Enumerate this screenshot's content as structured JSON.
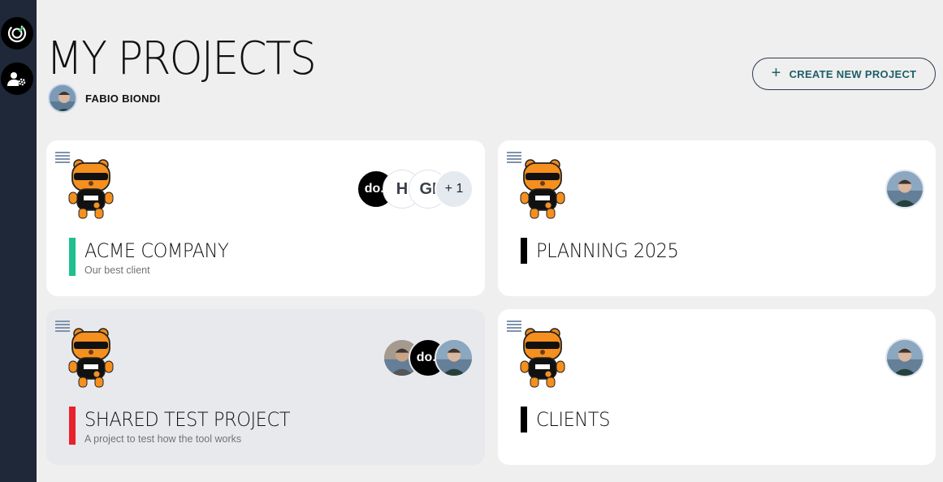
{
  "page": {
    "title": "MY PROJECTS"
  },
  "user": {
    "name": "FABIO BIONDI"
  },
  "actions": {
    "create_label": "CREATE NEW PROJECT"
  },
  "sidebar": {
    "items": [
      "app-logo",
      "user-settings"
    ]
  },
  "projects": [
    {
      "title": "ACME COMPANY",
      "subtitle": "Our best client",
      "accent": "#1fbf8f",
      "members": [
        {
          "kind": "logo",
          "text": "do.i"
        },
        {
          "kind": "letter",
          "text": "H"
        },
        {
          "kind": "letter",
          "text": "GI"
        },
        {
          "kind": "more",
          "text": "+ 1"
        }
      ]
    },
    {
      "title": "PLANNING 2025",
      "subtitle": "",
      "accent": "#000000",
      "members": [
        {
          "kind": "photo"
        }
      ]
    },
    {
      "title": "SHARED TEST PROJECT",
      "subtitle": "A project to test how the tool works",
      "accent": "#e8212a",
      "members": [
        {
          "kind": "photo"
        },
        {
          "kind": "logo",
          "text": "do.i"
        },
        {
          "kind": "photo"
        }
      ]
    },
    {
      "title": "CLIENTS",
      "subtitle": "",
      "accent": "#000000",
      "members": [
        {
          "kind": "photo"
        }
      ]
    }
  ],
  "colors": {
    "sidebar": "#1e2838",
    "background": "#efeff0",
    "button_text": "#1d5f66"
  }
}
